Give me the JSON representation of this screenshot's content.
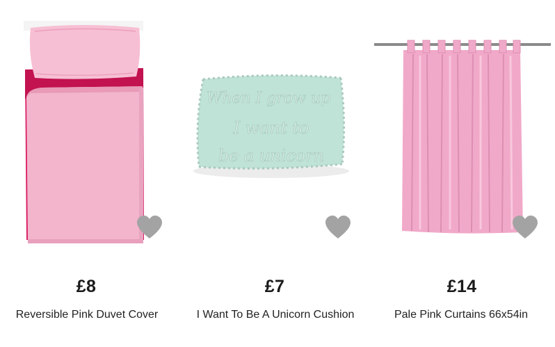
{
  "products": [
    {
      "price": "£8",
      "name": "Reversible Pink Duvet Cover",
      "image_icon": "duvet-cover-image",
      "wishlist_icon": "heart-icon"
    },
    {
      "price": "£7",
      "name": "I Want To Be A Unicorn Cushion",
      "image_icon": "cushion-image",
      "cushion_text": [
        "When I grow up",
        "I want to",
        "be a unicorn"
      ],
      "wishlist_icon": "heart-icon"
    },
    {
      "price": "£14",
      "name": "Pale Pink Curtains 66x54in",
      "image_icon": "curtains-image",
      "wishlist_icon": "heart-icon"
    }
  ],
  "colors": {
    "heart": "#a3a3a3",
    "duvet_pink": "#f3b5cc",
    "duvet_magenta": "#d81b62",
    "cushion_mint": "#bfe3d6",
    "curtain_pink": "#f1a9c9"
  }
}
